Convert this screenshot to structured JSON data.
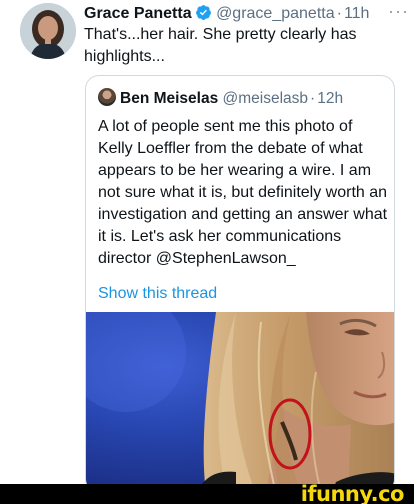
{
  "tweet": {
    "author_name": "Grace Panetta",
    "handle": "@grace_panetta",
    "separator": "·",
    "time": "11h",
    "more_icon": "more-horizontal-icon",
    "text": "That's...her hair. She pretty clearly has highlights..."
  },
  "quoted_tweet": {
    "author_name": "Ben Meiselas",
    "handle": "@meiselasb",
    "separator": "·",
    "time": "12h",
    "text": "A lot of people sent me this photo of Kelly Loeffler from the debate of what appears to be her wearing a wire.  I am not sure what it is, but definitely worth an investigation and getting an answer what it is. Let's ask her communications director @StephenLawson_",
    "show_thread_label": "Show this thread"
  },
  "watermark": {
    "text": "ifunny.co"
  },
  "colors": {
    "link": "#1b95e0",
    "secondary_text": "#5b7083",
    "verified_badge": "#1da1f2",
    "watermark": "#f5d80c"
  }
}
